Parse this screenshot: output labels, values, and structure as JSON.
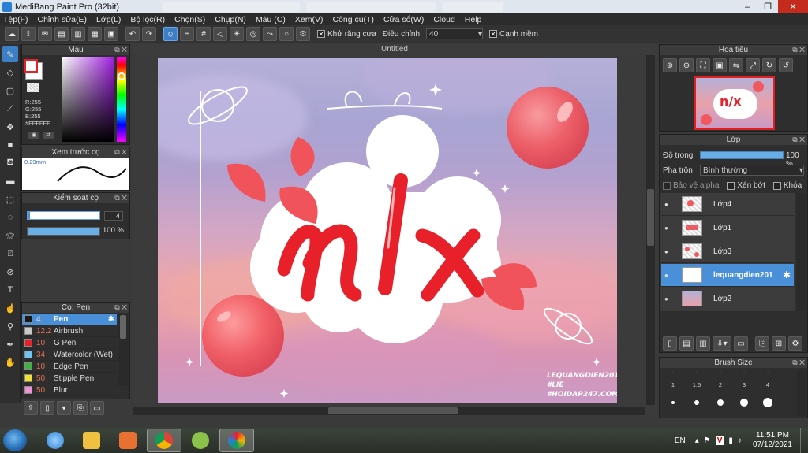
{
  "window": {
    "title": "MediBang Paint Pro (32bit)",
    "controls": {
      "minimize": "–",
      "restore": "❐",
      "close": "✕"
    }
  },
  "menu": [
    "Tệp(F)",
    "Chỉnh sửa(E)",
    "Lớp(L)",
    "Bộ lọc(R)",
    "Chọn(S)",
    "Chụp(N)",
    "Màu (C)",
    "Xem(V)",
    "Công cụ(T)",
    "Cửa sổ(W)",
    "Cloud",
    "Help"
  ],
  "toolbar": {
    "antialias_label": "Khử răng cưa",
    "antialias_checked": true,
    "adjust_label": "Điều chỉnh",
    "adjust_value": "40",
    "snap_label": "Cạnh mềm",
    "snap_checked": false
  },
  "color_panel": {
    "title": "Màu",
    "r_label": "R:255",
    "g_label": "G:255",
    "b_label": "B:255",
    "hex": "#FFFFFF",
    "primary_color": "#e8202a",
    "secondary_color": "#ffffff"
  },
  "preview_panel": {
    "title": "Xem trước cọ",
    "size_label": "0.29mm"
  },
  "brush_control": {
    "title": "Kiểm soát cọ",
    "size_value": "4",
    "opacity_value": "100 %",
    "opacity_fraction": 1.0
  },
  "brush_panel": {
    "title": "Cọ: Pen",
    "items": [
      {
        "size": "4",
        "name": "Pen",
        "color": "#1a1a1a",
        "selected": true
      },
      {
        "size": "12.2",
        "name": "Airbrush",
        "color": "#c8c8c8",
        "selected": false
      },
      {
        "size": "10",
        "name": "G Pen",
        "color": "#e8202a",
        "selected": false
      },
      {
        "size": "34",
        "name": "Watercolor (Wet)",
        "color": "#6fc3f0",
        "selected": false
      },
      {
        "size": "10",
        "name": "Edge Pen",
        "color": "#3db43d",
        "selected": false
      },
      {
        "size": "50",
        "name": "Stipple Pen",
        "color": "#f0e030",
        "selected": false
      },
      {
        "size": "50",
        "name": "Blur",
        "color": "#f090d8",
        "selected": false
      }
    ]
  },
  "canvas": {
    "title": "Untitled",
    "artwork_text": "n/x",
    "credit_lines": [
      "LEQUANGDIEN201",
      "#LIE",
      "#HOIDAP247.COM"
    ]
  },
  "navigator": {
    "title": "Hoa tiêu"
  },
  "layer_panel": {
    "title": "Lớp",
    "opacity_label": "Độ trong",
    "opacity_value": "100 %",
    "opacity_fraction": 1.0,
    "blend_label": "Pha trộn",
    "blend_value": "Bình thường",
    "protect_alpha_label": "Bảo vệ alpha",
    "clipping_label": "Xén bớt",
    "lock_label": "Khóa",
    "layers": [
      {
        "name": "Lớp4",
        "selected": false
      },
      {
        "name": "Lớp1",
        "selected": false
      },
      {
        "name": "Lớp3",
        "selected": false
      },
      {
        "name": "lequangdien201",
        "selected": true
      },
      {
        "name": "Lớp2",
        "selected": false
      }
    ]
  },
  "brush_size_panel": {
    "title": "Brush Size",
    "sizes": [
      "1",
      "1.5",
      "2",
      "3",
      "4"
    ]
  },
  "taskbar": {
    "language": "EN",
    "time": "11:51 PM",
    "date": "07/12/2021"
  }
}
